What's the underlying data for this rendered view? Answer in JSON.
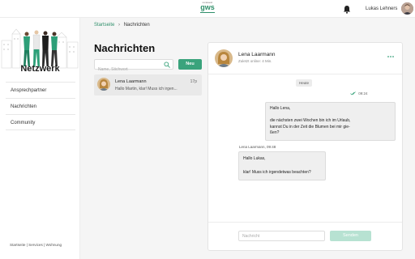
{
  "header": {
    "logo_tagline": "vivawest",
    "logo_text": "gws",
    "user_name": "Lukas Lehners"
  },
  "sidebar": {
    "title": "Netzwerk",
    "items": [
      {
        "label": "Ansprechpartner"
      },
      {
        "label": "Nachrichten"
      },
      {
        "label": "Community"
      }
    ],
    "footer": "Startseite | Services | Wohnung"
  },
  "breadcrumb": {
    "home": "Startseite",
    "current": "Nachrichten"
  },
  "messages_page": {
    "title": "Nachrichten",
    "search_placeholder": "Name, Stichwort",
    "new_button": "Neu",
    "conversations": [
      {
        "name": "Lena Laarmann",
        "time": "17p",
        "preview": "Hallo Martin, klar! Muss ich irgen..."
      }
    ]
  },
  "chat": {
    "contact_name": "Lena Laarmann",
    "status": "Zuletzt online: 4 Min.",
    "date_label": "Heute",
    "sent_time": "09:24",
    "sent_lines": [
      "Hallo Lena,",
      "",
      "die nächsten zwei Wochen bin ich im Urlaub,",
      "kannst Du in der Zeit die Blumen bei mir gie-",
      "ßen?"
    ],
    "received_meta": "Lena Laarmann, 09:48",
    "received_lines": [
      "Hallo Lukas,",
      "",
      "klar! Muss ich irgendetwas beachten?"
    ],
    "input_placeholder": "Nachricht",
    "send_button": "Senden"
  },
  "colors": {
    "accent": "#3aa37c",
    "accent_disabled": "#b7e2d2",
    "link": "#2f8f6a"
  },
  "icons": [
    "bell-icon",
    "search-icon",
    "more-icon",
    "double-check-icon"
  ]
}
